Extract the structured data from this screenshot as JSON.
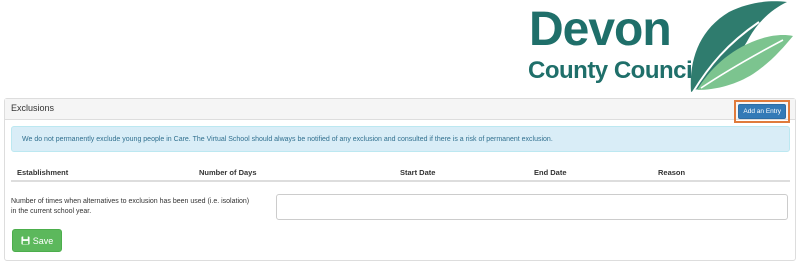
{
  "logo": {
    "word": "Devon",
    "subword": "County Council",
    "icon": "leaf-icon",
    "colors": {
      "text": "#1f6f6a",
      "leaf_dark": "#2f7c6e",
      "leaf_light": "#7cc48f"
    }
  },
  "panel": {
    "title": "Exclusions",
    "add_button_label": "Add an Entry",
    "alert_text": "We do not permanently exclude young people in Care. The Virtual School should always be notified of any exclusion and consulted if there is a risk of permanent exclusion."
  },
  "table": {
    "columns": [
      "Establishment",
      "Number of Days",
      "Start Date",
      "End Date",
      "Reason"
    ]
  },
  "alternatives": {
    "label_line1": "Number of times when alternatives to exclusion has been used (i.e. isolation)",
    "label_line2": "in the current school year.",
    "value": "",
    "placeholder": ""
  },
  "save": {
    "label": "Save",
    "icon": "floppy-disk-icon"
  },
  "colors": {
    "primary": "#337ab7",
    "success": "#5cb85c",
    "info_bg": "#d9edf7",
    "info_text": "#31708f",
    "highlight": "#e07b3c"
  }
}
